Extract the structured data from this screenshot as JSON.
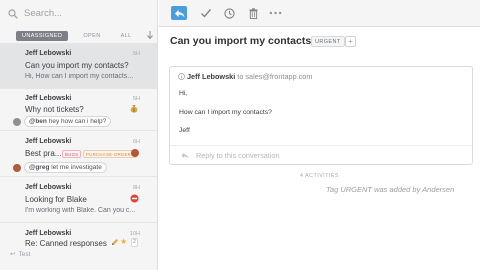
{
  "search": {
    "placeholder": "Search..."
  },
  "filters": {
    "unassigned": "UNASSIGNED",
    "open": "OPEN",
    "all": "ALL"
  },
  "conversations": [
    {
      "name": "Jeff Lebowski",
      "time": "5H",
      "subject": "Can you import my contacts?",
      "preview": "Hi, How can I import my contacts..."
    },
    {
      "name": "Jeff Lebowski",
      "time": "5H",
      "subject": "Why not tickets?",
      "comment_author": "@ben",
      "comment_text": " hey how can i help?"
    },
    {
      "name": "Jeff Lebowski",
      "time": "6H",
      "subject": "Best pra...",
      "tags": [
        "BUGS",
        "PURCHASE-ORDERS"
      ],
      "comment_author": "@greg",
      "comment_text": " let me investigate"
    },
    {
      "name": "Jeff Lebowski",
      "time": "8H",
      "subject": "Looking for Blake",
      "preview": "I'm working with Blake. Can you c..."
    },
    {
      "name": "Jeff Lebowski",
      "time": "10H",
      "subject": "Re: Canned responses",
      "count": "2",
      "reply_preview": "Test"
    }
  ],
  "conversation": {
    "title": "Can you import my contacts?",
    "tag": "URGENT",
    "add_tag": "+",
    "message": {
      "from": "Jeff Lebowski",
      "to_label": " to sales@frontapp.com",
      "lines": [
        "Hi,",
        "How can I import my contacts?",
        "Jeff"
      ]
    },
    "reply_placeholder": "Reply to this conversation",
    "activities_label": "4 ACTIVITIES",
    "activity_text": "Tag URGENT was added by Andersen"
  },
  "colors": {
    "accent": "#4a9ee0",
    "bugs_tag": "#e0516b",
    "purchase_orders_tag": "#e08b2b"
  },
  "icons": [
    "search-icon",
    "sort-arrow-icon",
    "reply-icon",
    "check-icon",
    "snooze-clock-icon",
    "trash-icon",
    "more-icon",
    "info-icon",
    "pencil-icon",
    "urgent-icon",
    "money-bag-icon",
    "reply-arrow-icon"
  ]
}
